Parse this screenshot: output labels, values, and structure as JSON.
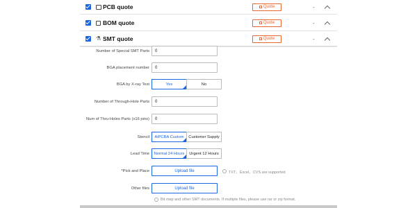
{
  "quotes": [
    {
      "label": "PCB quote",
      "icon": "pcb-board-icon",
      "button": "Quote",
      "dash": "-"
    },
    {
      "label": "BOM quote",
      "icon": "checkbox-outline-icon",
      "button": "Quote",
      "dash": "-"
    },
    {
      "label": "SMT quote",
      "icon": "microscope-icon",
      "button": "Quote",
      "dash": "-"
    }
  ],
  "form": {
    "special_smt": {
      "label": "Number of Special SMT Parts",
      "value": "0"
    },
    "bga_placement": {
      "label": "BGA placement number",
      "value": "0"
    },
    "bga_xray": {
      "label": "BGA by X-ray Test",
      "options": [
        "Yes",
        "No"
      ],
      "selected": "Yes"
    },
    "through_hole": {
      "label": "Number of Through-Hole Parts",
      "value": "0"
    },
    "thru_pins": {
      "label": "Num of Thru-Holes Parts (x16 pins)",
      "value": "0"
    },
    "stencil": {
      "label": "Stencil",
      "options": [
        "AiPCBA Custom",
        "Customer Supply"
      ],
      "selected": "AiPCBA Custom"
    },
    "lead_time": {
      "label": "Lead Time",
      "options": [
        "Normal 24 Hours",
        "Urgent 12 Hours"
      ],
      "selected": "Normal 24 Hours"
    },
    "pick_place": {
      "label": "*Pick and Place",
      "button": "Upload file",
      "note": "TXT、Excel、CVS are supported"
    },
    "other_files": {
      "label": "Other files",
      "button": "Upload file",
      "note": "Bit map and other SMT documents. If multiple files, please use rar or zip format."
    }
  },
  "colors": {
    "accent": "#1a66e0",
    "quote": "#e8652e"
  }
}
